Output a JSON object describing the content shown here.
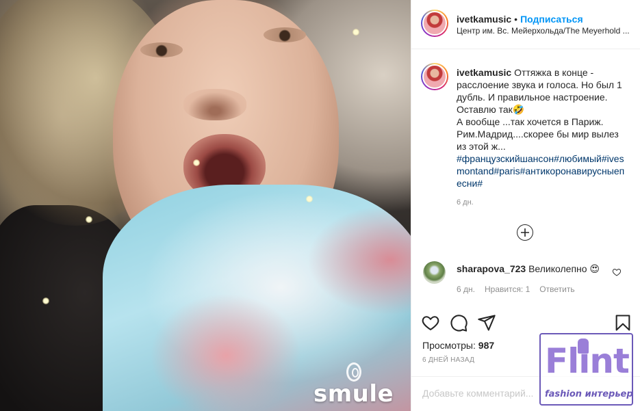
{
  "post": {
    "username": "ivetkamusic",
    "follow_label": "Подписаться",
    "location": "Центр им. Вс. Мейерхольда/The Meyerhold ...",
    "caption_line1": "Оттяжка в конце - расслоение звука и голоса. Но был 1 дубль. И правильное настроение. Оставлю так🤣",
    "caption_line2": "А вообще ...так хочется в Париж. Рим.Мадрид....скорее бы мир вылез из этой ж...",
    "hashtags": "#французскийшансон#любимый#ivesmontand#paris#антикоронавирусныепесни#",
    "caption_time": "6 дн."
  },
  "comments": [
    {
      "username": "sharapova_723",
      "text": "Великолепно 😍",
      "time": "6 дн.",
      "likes_label": "Нравится: 1",
      "reply_label": "Ответить"
    }
  ],
  "stats": {
    "views_label": "Просмотры:",
    "views_count": "987",
    "posted_ago": "6 ДНЕЙ НАЗАД"
  },
  "input": {
    "add_comment_placeholder": "Добавьте комментарий..."
  },
  "media": {
    "watermark_text": "smule"
  },
  "watermark": {
    "title": "Flint",
    "subtitle": "fashion интерьер"
  },
  "icons": {
    "load_more": "plus-circle-icon",
    "like": "heart-icon",
    "comment": "speech-bubble-icon",
    "share": "paper-plane-icon",
    "save": "bookmark-icon"
  },
  "colors": {
    "link_blue": "#0095f6",
    "hashtag": "#00376b",
    "muted": "#8e8e8e",
    "watermark_purple": "#9a7fd8"
  }
}
